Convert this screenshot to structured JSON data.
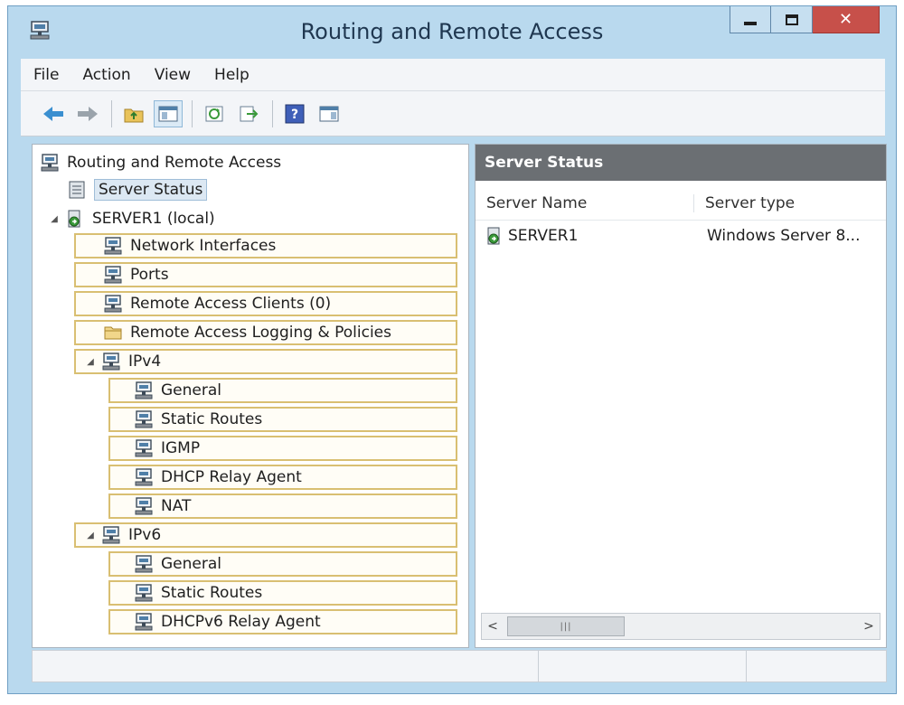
{
  "window": {
    "title": "Routing and Remote Access"
  },
  "menu": [
    "File",
    "Action",
    "View",
    "Help"
  ],
  "toolbar": {
    "buttons": [
      {
        "icon": "back-arrow-icon"
      },
      {
        "icon": "forward-arrow-icon"
      },
      {
        "icon": "up-folder-icon"
      },
      {
        "icon": "show-hide-tree-icon"
      },
      {
        "icon": "refresh-icon"
      },
      {
        "icon": "export-list-icon"
      },
      {
        "icon": "help-icon"
      },
      {
        "icon": "properties-icon"
      }
    ]
  },
  "tree": {
    "root": "Routing and Remote Access",
    "server_status": "Server Status",
    "server": "SERVER1 (local)",
    "network_interfaces": "Network Interfaces",
    "ports": "Ports",
    "remote_access_clients": "Remote Access Clients (0)",
    "logging_policies": "Remote Access Logging & Policies",
    "ipv4": "IPv4",
    "ipv4_general": "General",
    "ipv4_static_routes": "Static Routes",
    "ipv4_igmp": "IGMP",
    "ipv4_dhcp_relay": "DHCP Relay Agent",
    "ipv4_nat": "NAT",
    "ipv6": "IPv6",
    "ipv6_general": "General",
    "ipv6_static_routes": "Static Routes",
    "ipv6_dhcpv6_relay": "DHCPv6 Relay Agent"
  },
  "details": {
    "header": "Server Status",
    "columns": [
      "Server Name",
      "Server type"
    ],
    "rows": [
      {
        "name": "SERVER1",
        "type": "Windows Server 8..."
      }
    ]
  },
  "colors": {
    "title_bar": "#b9d9ee",
    "close_button": "#c7504a",
    "pane_header": "#6b6f73",
    "highlight_border": "#d9bf72"
  }
}
